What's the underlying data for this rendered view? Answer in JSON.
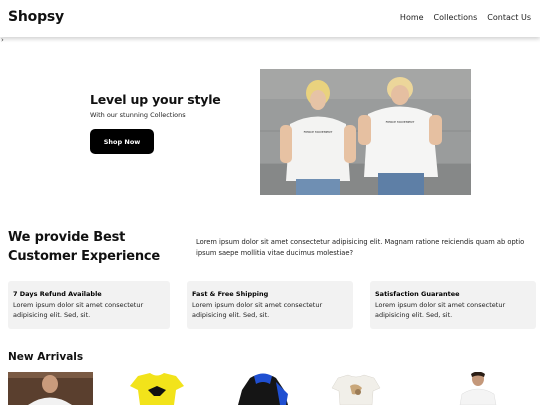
{
  "brand": "Shopsy",
  "nav": {
    "links": [
      "Home",
      "Collections",
      "Contact Us"
    ]
  },
  "stray_glyph": "›",
  "hero": {
    "title": "Level up your style",
    "subtitle": "With our stunning Collections",
    "cta_label": "Shop Now",
    "shirt_print": "FIERCE MOVEMENT"
  },
  "about": {
    "title_line1": "We provide Best",
    "title_line2": "Customer Experience",
    "description": "Lorem ipsum dolor sit amet consectetur adipisicing elit. Magnam ratione reiciendis quam ab optio ipsum saepe mollitia vitae ducimus molestiae?"
  },
  "features": [
    {
      "title": "7 Days Refund Available",
      "text": "Lorem ipsum dolor sit amet consectetur adipisicing elit. Sed, sit."
    },
    {
      "title": "Fast & Free Shipping",
      "text": "Lorem ipsum dolor sit amet consectetur adipisicing elit. Sed, sit."
    },
    {
      "title": "Satisfaction Guarantee",
      "text": "Lorem ipsum dolor sit amet consectetur adipisicing elit. Sed, sit."
    }
  ],
  "new_arrivals": {
    "title": "New Arrivals",
    "products": [
      {
        "icon": "model-photo"
      },
      {
        "icon": "yellow-tshirt"
      },
      {
        "icon": "black-blue-hoodie"
      },
      {
        "icon": "printed-white-tshirt"
      },
      {
        "icon": "white-tshirt-model"
      }
    ]
  },
  "colors": {
    "accent": "#000000",
    "card_bg": "#f2f2f2",
    "yellow_product": "#f2e31a",
    "hoodie_blue": "#1f4fd1"
  }
}
